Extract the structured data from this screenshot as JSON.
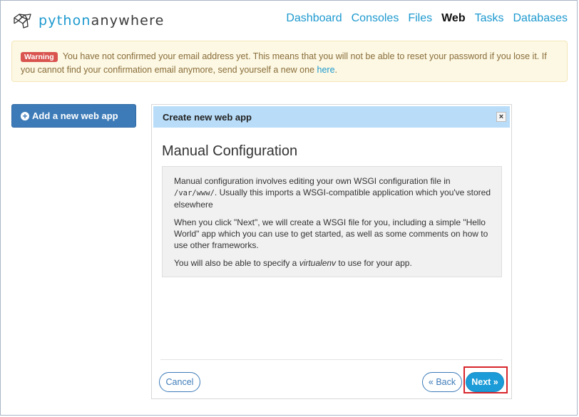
{
  "brand": {
    "prefix": "python",
    "suffix": "anywhere"
  },
  "nav": {
    "dashboard": "Dashboard",
    "consoles": "Consoles",
    "files": "Files",
    "web": "Web",
    "tasks": "Tasks",
    "databases": "Databases"
  },
  "warning": {
    "badge": "Warning",
    "message": "You have not confirmed your email address yet. This means that you will not be able to reset your password if you lose it. If you cannot find your confirmation email anymore, send yourself a new one",
    "link": "here",
    "end": "."
  },
  "sidebar": {
    "add_button": "Add a new web app"
  },
  "modal": {
    "title": "Create new web app",
    "close": "×",
    "heading": "Manual Configuration",
    "para1_a": "Manual configuration involves editing your own WSGI configuration file in",
    "para1_code": "/var/www/",
    "para1_b": ". Usually this imports a WSGI-compatible application which you've stored elsewhere",
    "para2": "When you click \"Next\", we will create a WSGI file for you, including a simple \"Hello World\" app which you can use to get started, as well as some comments on how to use other frameworks.",
    "para3_a": "You will also be able to specify a",
    "para3_em": "virtualenv",
    "para3_b": "to use for your app.",
    "cancel": "Cancel",
    "back": "« Back",
    "next": "Next »"
  },
  "colors": {
    "accent": "#1d99cf",
    "primary_button": "#3d7bb8",
    "header_bg": "#b9ddf9",
    "highlight": "#d7262b"
  }
}
